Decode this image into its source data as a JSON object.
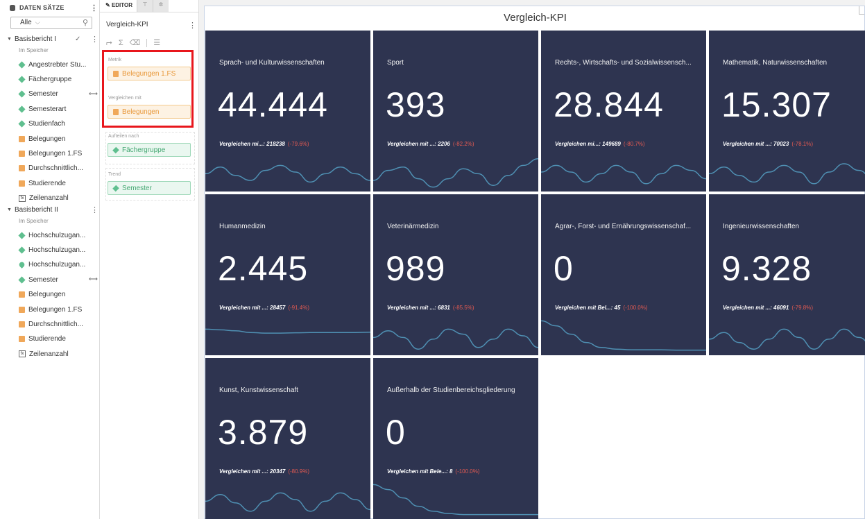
{
  "datasets_panel": {
    "header": "DATEN SÄTZE",
    "filter": "Alle",
    "groups": [
      {
        "name": "Basisbericht I",
        "sub": "Im Speicher",
        "items": [
          {
            "label": "Angestrebter Stu...",
            "type": "dimension"
          },
          {
            "label": "Fächergruppe",
            "type": "dimension"
          },
          {
            "label": "Semester",
            "type": "dimension"
          },
          {
            "label": "Semesterart",
            "type": "dimension"
          },
          {
            "label": "Studienfach",
            "type": "dimension"
          },
          {
            "label": "Belegungen",
            "type": "measure"
          },
          {
            "label": "Belegungen 1.FS",
            "type": "measure"
          },
          {
            "label": "Durchschnittlich...",
            "type": "measure"
          },
          {
            "label": "Studierende",
            "type": "measure"
          },
          {
            "label": "Zeilenanzahl",
            "type": "calculated"
          }
        ]
      },
      {
        "name": "Basisbericht II",
        "sub": "Im Speicher",
        "items": [
          {
            "label": "Hochschulzugan...",
            "type": "dimension"
          },
          {
            "label": "Hochschulzugan...",
            "type": "dimension"
          },
          {
            "label": "Hochschulzugan...",
            "type": "geo"
          },
          {
            "label": "Semester",
            "type": "dimension"
          },
          {
            "label": "Belegungen",
            "type": "measure"
          },
          {
            "label": "Belegungen 1.FS",
            "type": "measure"
          },
          {
            "label": "Durchschnittlich...",
            "type": "measure"
          },
          {
            "label": "Studierende",
            "type": "measure"
          },
          {
            "label": "Zeilenanzahl",
            "type": "calculated"
          }
        ]
      }
    ]
  },
  "editor": {
    "tab_label": "EDITOR",
    "title": "Vergleich-KPI",
    "metric_label": "Metrik",
    "metric_value": "Belegungen 1.FS",
    "compare_label": "Vergleichen mit",
    "compare_value": "Belegungen",
    "split_label": "Aufteilen nach",
    "split_value": "Fächergruppe",
    "trend_label": "Trend",
    "trend_value": "Semester"
  },
  "canvas": {
    "title": "Vergleich-KPI",
    "tiles": [
      {
        "title": "Sprach- und Kulturwissenschaften",
        "value": "44.444",
        "compare": "Vergleichen mi...: 218238",
        "pct": "(-79.6%)",
        "trend": [
          0.55,
          0.35,
          0.6,
          0.75,
          0.45,
          0.3,
          0.5,
          0.8,
          0.55,
          0.35,
          0.55,
          0.75
        ]
      },
      {
        "title": "Sport",
        "value": "393",
        "compare": "Vergleichen mit ...: 2206",
        "pct": "(-82.2%)",
        "trend": [
          0.75,
          0.45,
          0.35,
          0.7,
          0.95,
          0.7,
          0.4,
          0.55,
          0.9,
          0.6,
          0.3,
          0.1
        ]
      },
      {
        "title": "Rechts-, Wirtschafts- und Sozialwissensch...",
        "value": "28.844",
        "compare": "Vergleichen mi...: 149689",
        "pct": "(-80.7%)",
        "trend": [
          0.5,
          0.3,
          0.5,
          0.8,
          0.55,
          0.3,
          0.5,
          0.85,
          0.55,
          0.3,
          0.45,
          0.7
        ]
      },
      {
        "title": "Mathematik, Naturwissenschaften",
        "value": "15.307",
        "compare": "Vergleichen mit ...: 70023",
        "pct": "(-78.1%)",
        "trend": [
          0.55,
          0.35,
          0.6,
          0.8,
          0.5,
          0.3,
          0.5,
          0.85,
          0.5,
          0.25,
          0.45,
          0.75
        ]
      },
      {
        "title": "Humanmedizin",
        "value": "2.445",
        "compare": "Vergleichen mit ...: 28457",
        "pct": "(-91.4%)",
        "trend": [
          0.3,
          0.32,
          0.35,
          0.4,
          0.42,
          0.42,
          0.41,
          0.4,
          0.4,
          0.4,
          0.4,
          0.39
        ]
      },
      {
        "title": "Veterinärmedizin",
        "value": "989",
        "compare": "Vergleichen mit ...: 6831",
        "pct": "(-85.5%)",
        "trend": [
          0.55,
          0.35,
          0.55,
          0.9,
          0.6,
          0.3,
          0.45,
          0.85,
          0.6,
          0.3,
          0.5,
          0.85
        ]
      },
      {
        "title": "Agrar-, Forst- und Ernährungswissenschaf...",
        "value": "0",
        "compare": "Vergleichen mit Bel...: 45",
        "pct": "(-100.0%)",
        "trend": [
          0.05,
          0.2,
          0.45,
          0.7,
          0.85,
          0.9,
          0.92,
          0.92,
          0.92,
          0.93,
          0.93,
          0.93
        ]
      },
      {
        "title": "Ingenieurwissenschaften",
        "value": "9.328",
        "compare": "Vergleichen mit ...: 46091",
        "pct": "(-79.8%)",
        "trend": [
          0.6,
          0.4,
          0.7,
          0.9,
          0.6,
          0.3,
          0.55,
          0.9,
          0.6,
          0.3,
          0.55,
          0.85
        ]
      },
      {
        "title": "Kunst, Kunstwissenschaft",
        "value": "3.879",
        "compare": "Vergleichen mit ...: 20347",
        "pct": "(-80.9%)",
        "trend": [
          0.55,
          0.35,
          0.6,
          0.85,
          0.55,
          0.3,
          0.5,
          0.85,
          0.55,
          0.3,
          0.5,
          0.8
        ]
      },
      {
        "title": "Außerhalb der Studienbereichsgliederung",
        "value": "0",
        "compare": "Vergleichen mit Bele...: 8",
        "pct": "(-100.0%)",
        "trend": [
          0.05,
          0.2,
          0.45,
          0.7,
          0.85,
          0.92,
          0.95,
          0.95,
          0.95,
          0.95,
          0.95,
          0.95
        ]
      }
    ]
  },
  "colors": {
    "tile_bg": "#2e3450",
    "trend_line": "#4f90b3",
    "negative": "#e35a52",
    "highlight": "#e8161c"
  }
}
